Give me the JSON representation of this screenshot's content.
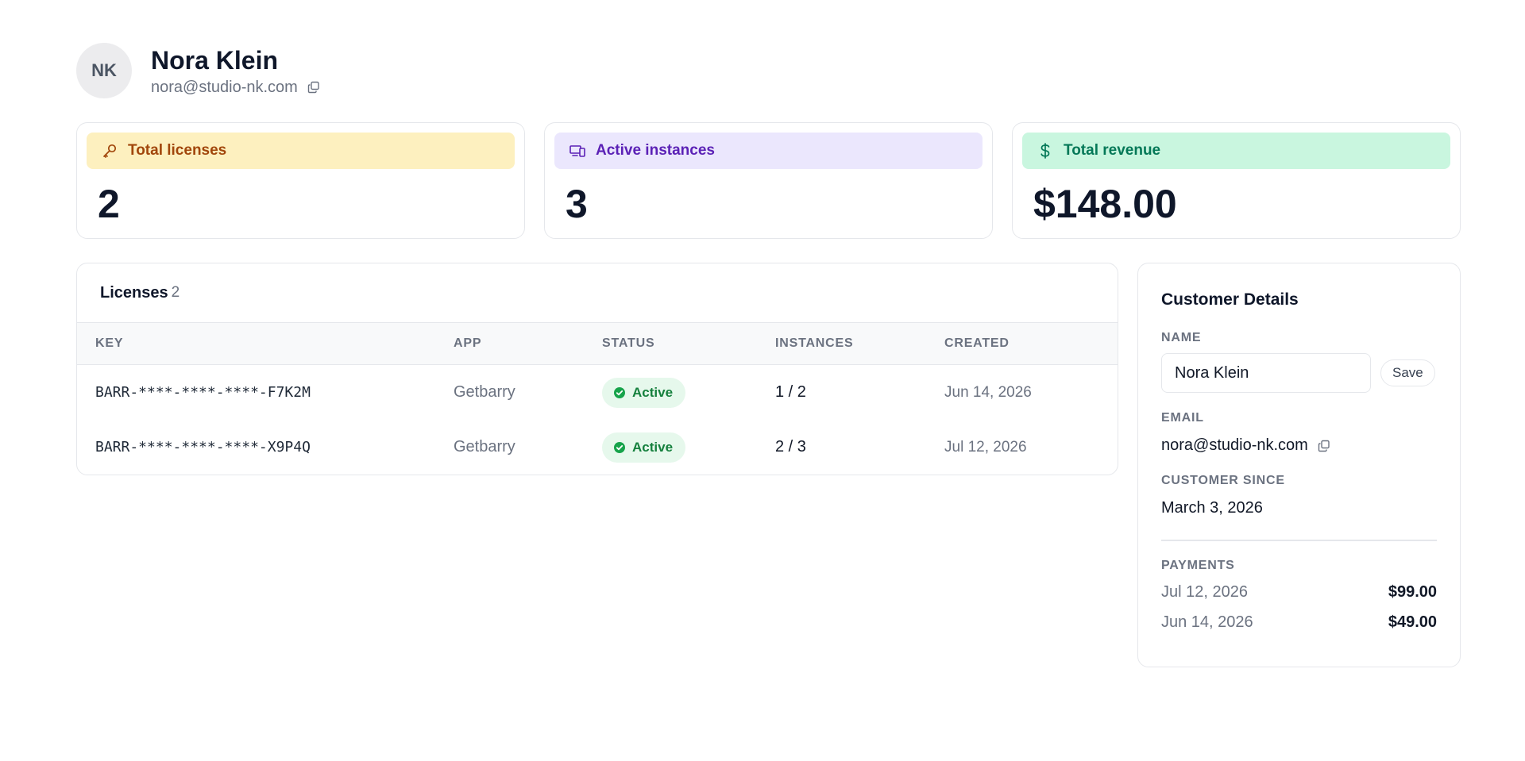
{
  "customer": {
    "initials": "NK",
    "name": "Nora Klein",
    "email": "nora@studio-nk.com"
  },
  "stats": [
    {
      "label": "Total licenses",
      "value": "2",
      "icon": "key-icon",
      "color": "#a1460b",
      "bg": "#fdf0bf"
    },
    {
      "label": "Active instances",
      "value": "3",
      "icon": "devices-icon",
      "color": "#5b21b6",
      "bg": "#ebe7fd"
    },
    {
      "label": "Total revenue",
      "value": "$148.00",
      "icon": "dollar-icon",
      "color": "#047857",
      "bg": "#c9f6df"
    }
  ],
  "licenses": {
    "title": "Licenses",
    "count": "2",
    "columns": [
      "KEY",
      "APP",
      "STATUS",
      "INSTANCES",
      "CREATED"
    ],
    "rows": [
      {
        "key": "BARR-****-****-****-F7K2M",
        "app": "Getbarry",
        "status": "Active",
        "instances": "1 / 2",
        "created": "Jun 14, 2026"
      },
      {
        "key": "BARR-****-****-****-X9P4Q",
        "app": "Getbarry",
        "status": "Active",
        "instances": "2 / 3",
        "created": "Jul 12, 2026"
      }
    ]
  },
  "details": {
    "title": "Customer Details",
    "name_label": "NAME",
    "name_value": "Nora Klein",
    "save_label": "Save",
    "email_label": "EMAIL",
    "email_value": "nora@studio-nk.com",
    "since_label": "CUSTOMER SINCE",
    "since_value": "March 3, 2026",
    "payments_label": "PAYMENTS",
    "payments": [
      {
        "date": "Jul 12, 2026",
        "amount": "$99.00"
      },
      {
        "date": "Jun 14, 2026",
        "amount": "$49.00"
      }
    ]
  }
}
